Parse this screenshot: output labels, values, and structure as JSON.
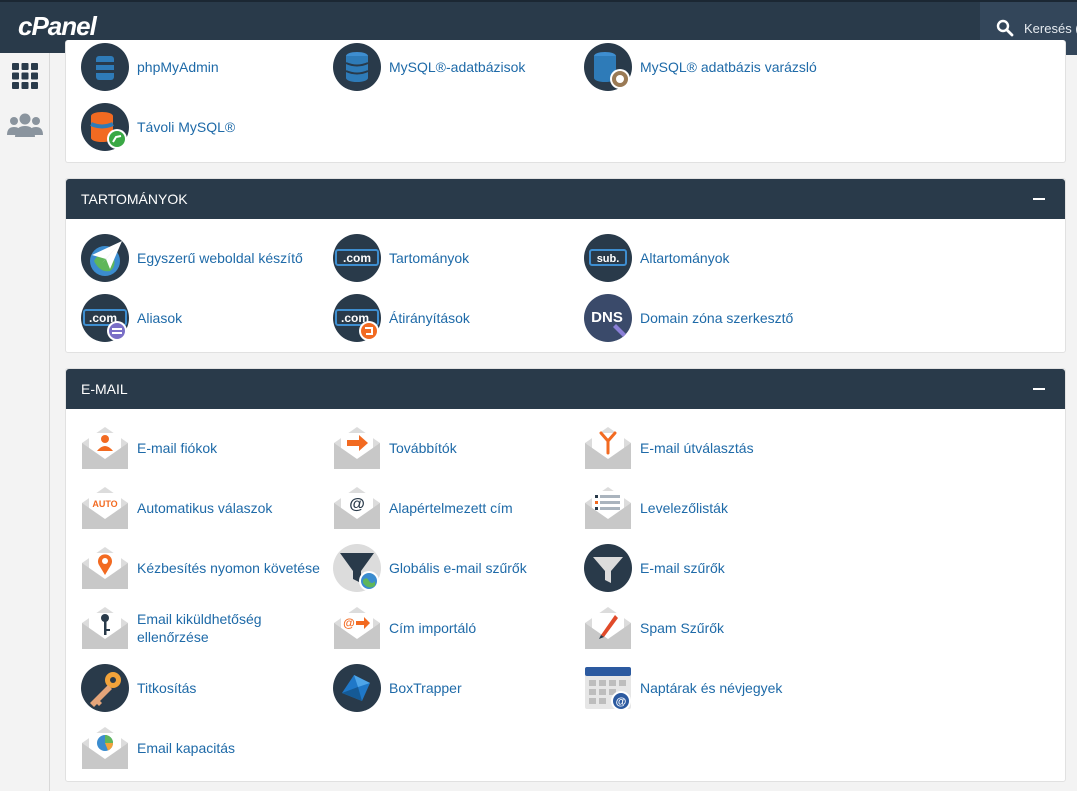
{
  "header": {
    "logo": "cPanel",
    "search_label": "Keresés ("
  },
  "nav": {
    "tools_icon": "grid-icon",
    "users_icon": "users-icon"
  },
  "database": {
    "items": [
      {
        "label": "phpMyAdmin",
        "icon": "phpmyadmin-icon"
      },
      {
        "label": "MySQL®-adatbázisok",
        "icon": "mysql-databases-icon"
      },
      {
        "label": "MySQL® adatbázis varázsló",
        "icon": "mysql-wizard-icon"
      },
      {
        "label": "Távoli MySQL®",
        "icon": "remote-mysql-icon"
      }
    ]
  },
  "domains": {
    "title": "TARTOMÁNYOK",
    "items": [
      {
        "label": "Egyszerű weboldal készítő",
        "icon": "site-publisher-icon"
      },
      {
        "label": "Tartományok",
        "icon": "domains-icon",
        "badge": ".com"
      },
      {
        "label": "Altartományok",
        "icon": "subdomains-icon",
        "badge": "sub."
      },
      {
        "label": "Aliasok",
        "icon": "aliases-icon",
        "badge": ".com"
      },
      {
        "label": "Átirányítások",
        "icon": "redirects-icon",
        "badge": ".com"
      },
      {
        "label": "Domain zóna szerkesztő",
        "icon": "dns-zone-editor-icon",
        "badge": "DNS"
      }
    ]
  },
  "email": {
    "title": "E-MAIL",
    "items": [
      {
        "label": "E-mail fiókok",
        "icon": "email-accounts-icon"
      },
      {
        "label": "Továbbítók",
        "icon": "forwarders-icon"
      },
      {
        "label": "E-mail útválasztás",
        "icon": "email-routing-icon"
      },
      {
        "label": "Automatikus válaszok",
        "icon": "autoresponders-icon",
        "badge": "AUTO"
      },
      {
        "label": "Alapértelmezett cím",
        "icon": "default-address-icon",
        "badge": "@"
      },
      {
        "label": "Levelezőlisták",
        "icon": "mailing-lists-icon"
      },
      {
        "label": "Kézbesítés nyomon követése",
        "icon": "track-delivery-icon"
      },
      {
        "label": "Globális e-mail szűrők",
        "icon": "global-email-filters-icon"
      },
      {
        "label": "E-mail szűrők",
        "icon": "email-filters-icon"
      },
      {
        "label": "Email kiküldhetőség\nellenőrzése",
        "icon": "email-deliverability-icon"
      },
      {
        "label": "Cím importáló",
        "icon": "address-importer-icon",
        "badge": "@"
      },
      {
        "label": "Spam Szűrők",
        "icon": "spam-filters-icon"
      },
      {
        "label": "Titkosítás",
        "icon": "encryption-icon"
      },
      {
        "label": "BoxTrapper",
        "icon": "boxtrapper-icon"
      },
      {
        "label": "Naptárak és névjegyek",
        "icon": "calendars-contacts-icon",
        "badge": "@"
      },
      {
        "label": "Email kapacitás",
        "icon": "email-disk-usage-icon"
      }
    ]
  },
  "colors": {
    "header": "#293a4a",
    "link": "#1e6aa8",
    "accent": "#f26a21",
    "icon_dark": "#293a4a"
  }
}
